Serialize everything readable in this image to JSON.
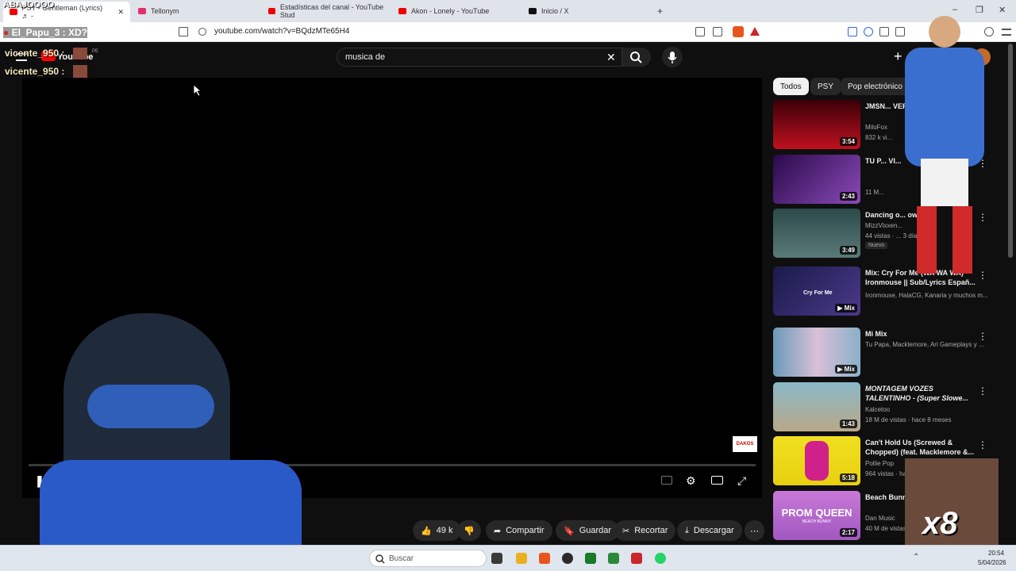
{
  "browser": {
    "tabs": [
      {
        "label": "PSY - Gentleman (Lyrics) ♬ -"
      },
      {
        "label": "Tellonym"
      },
      {
        "label": "Estadísticas del canal - YouTube Stud"
      },
      {
        "label": "Akon - Lonely - YouTube"
      },
      {
        "label": "Inicio / X"
      }
    ],
    "new_tab": "+",
    "url": "youtube.com/watch?v=BQdzMTe65H4",
    "window_controls": [
      "–",
      "❐",
      "✕"
    ]
  },
  "overlay": {
    "top_text": "ABAJOOOO",
    "user_line": "El_Papu_3 : XD?",
    "chat": [
      {
        "text": "vicente_950 :"
      },
      {
        "text": "vicente_950 :"
      }
    ],
    "multiplier": "x8"
  },
  "youtube": {
    "logo": "YouTube",
    "country": "PE",
    "search": {
      "value": "musica de"
    },
    "chips": [
      "Todos",
      "PSY",
      "Pop electrónico"
    ],
    "player": {
      "watermark": "DAKOS"
    },
    "actions": {
      "like_count": "49 k",
      "share": "Compartir",
      "save": "Guardar",
      "clip": "Recortar",
      "download": "Descargar"
    },
    "recommendations": [
      {
        "title": "JMSN... VERSIÓ...",
        "channel": "MiloFox",
        "meta": "832 k vi...",
        "duration": "3:54"
      },
      {
        "title": "TU P... VI...",
        "channel": "",
        "meta": "11 M...",
        "duration": "2:43"
      },
      {
        "title": "Dancing o... own",
        "channel": "MizzVixxen...",
        "meta": "44 vistas · ... 3 días",
        "duration": "3:49",
        "badge": "Nuevo"
      },
      {
        "title": "Mix: Cry For Me (WA WA WA) - Ironmouse || Sub/Lyrics Españ...",
        "channel": "Ironmouse, HalaCG, Kanaria y muchos m...",
        "meta": "",
        "duration": "Mix",
        "thumb_text": "Cry For Me"
      },
      {
        "title": "Mi Mix",
        "channel": "Tu Papa, Macklemore, Ari Gameplays y ...",
        "meta": "",
        "duration": "Mix"
      },
      {
        "title": "MONTAGEM VOZES TALENTINHO - (Super Slowe...",
        "channel": "Kalcetoo",
        "meta": "18 M de vistas · hace 8 meses",
        "duration": "1:43"
      },
      {
        "title": "Can't Hold Us (Screwed & Chopped) (feat. Macklemore &...",
        "channel": "Pollie Pop",
        "meta": "964 vistas · ha...",
        "duration": "5:18"
      },
      {
        "title": "Beach Bunny... (Lyrics)",
        "channel": "Dan Music",
        "meta": "40 M de vistas",
        "duration": "2:17",
        "thumb_text": "PROM QUEEN",
        "thumb_sub": "BEACH BUNNY"
      }
    ]
  },
  "taskbar": {
    "search_label": "Buscar",
    "time": "20:54",
    "date": "5/04/2026"
  }
}
